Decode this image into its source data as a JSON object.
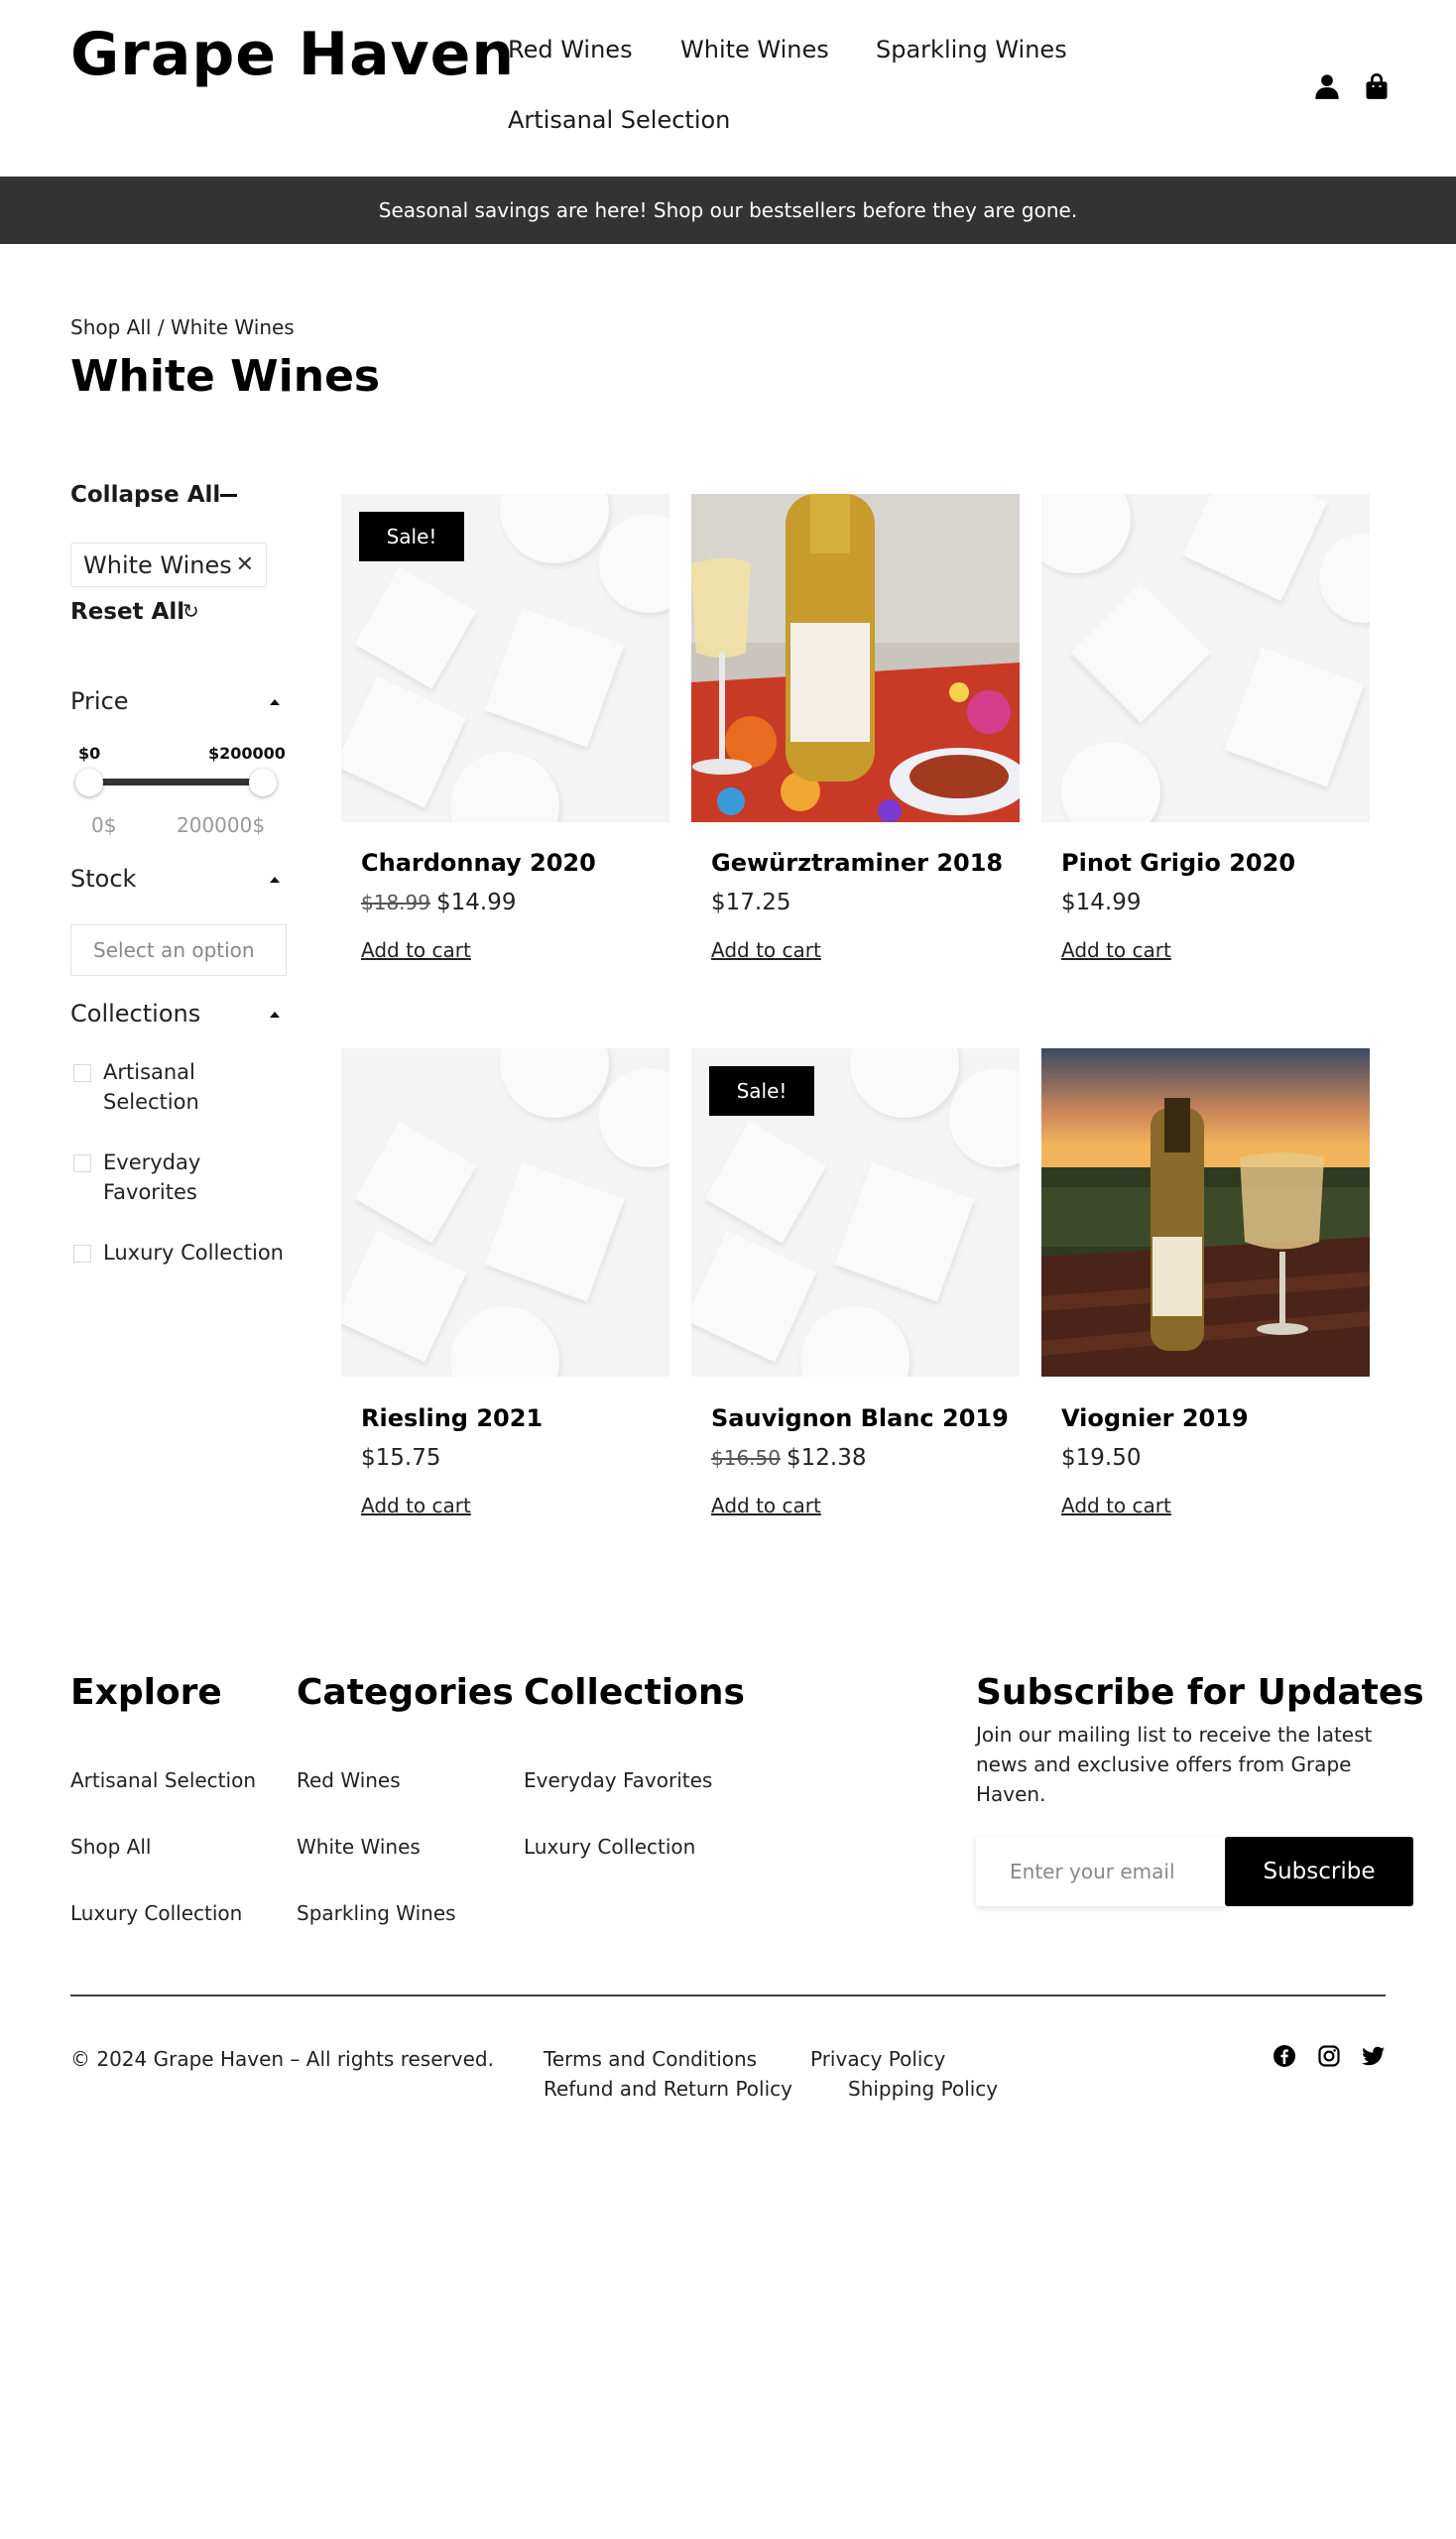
{
  "brand": {
    "logo_text": "Grape Haven"
  },
  "nav": {
    "items": [
      "Red Wines",
      "White Wines",
      "Sparkling Wines",
      "Artisanal Selection"
    ],
    "account_icon": "user-icon",
    "cart_icon": "shopping-bag-icon"
  },
  "announcement": "Seasonal savings are here! Shop our bestsellers before they are gone.",
  "breadcrumb": "Shop All / White Wines",
  "page_title": "White Wines",
  "filters": {
    "collapse_all": "Collapse All",
    "active_filter": "White Wines",
    "remove_icon": "close-icon",
    "reset_all": "Reset All",
    "reset_icon": "refresh-icon",
    "price": {
      "title": "Price",
      "min_label": "$0",
      "max_label": "$200000",
      "min_value": "0$",
      "max_value": "200000$",
      "range_fraction": [
        0,
        1
      ]
    },
    "stock": {
      "title": "Stock",
      "placeholder": "Select an option"
    },
    "collections": {
      "title": "Collections",
      "options": [
        {
          "label": "Artisanal Selection",
          "checked": false
        },
        {
          "label": "Everyday Favorites",
          "checked": false
        },
        {
          "label": "Luxury Collection",
          "checked": false
        }
      ]
    }
  },
  "products": [
    {
      "name": "Chardonnay 2020",
      "old_price": "$18.99",
      "price": "$14.99",
      "badge": "Sale!",
      "image": "placeholder",
      "cta": "Add to cart"
    },
    {
      "name": "Gewürztraminer 2018",
      "old_price": "",
      "price": "$17.25",
      "badge": "",
      "image": "wine-bottle-photo",
      "cta": "Add to cart"
    },
    {
      "name": "Pinot Grigio 2020",
      "old_price": "",
      "price": "$14.99",
      "badge": "",
      "image": "placeholder",
      "cta": "Add to cart"
    },
    {
      "name": "Riesling 2021",
      "old_price": "",
      "price": "$15.75",
      "badge": "",
      "image": "placeholder",
      "cta": "Add to cart"
    },
    {
      "name": "Sauvignon Blanc 2019",
      "old_price": "$16.50",
      "price": "$12.38",
      "badge": "Sale!",
      "image": "placeholder",
      "cta": "Add to cart"
    },
    {
      "name": "Viognier 2019",
      "old_price": "",
      "price": "$19.50",
      "badge": "",
      "image": "sunset-vineyard-photo",
      "cta": "Add to cart"
    }
  ],
  "footer": {
    "explore": {
      "title": "Explore",
      "links": [
        "Artisanal Selection",
        "Shop All",
        "Luxury Collection"
      ]
    },
    "categories": {
      "title": "Categories",
      "links": [
        "Red Wines",
        "White Wines",
        "Sparkling Wines"
      ]
    },
    "collections": {
      "title": "Collections",
      "links": [
        "Everyday Favorites",
        "Luxury Collection"
      ]
    },
    "subscribe": {
      "title": "Subscribe for Updates",
      "text": "Join our mailing list to receive the latest news and exclusive offers from Grape Haven.",
      "placeholder": "Enter your email",
      "button": "Subscribe"
    },
    "copyright": "© 2024 Grape Haven – All rights reserved.",
    "legal_links": [
      "Terms and Conditions",
      "Privacy Policy",
      "Refund and Return Policy",
      "Shipping Policy"
    ],
    "social_icons": [
      "facebook-icon",
      "instagram-icon",
      "twitter-icon"
    ]
  }
}
